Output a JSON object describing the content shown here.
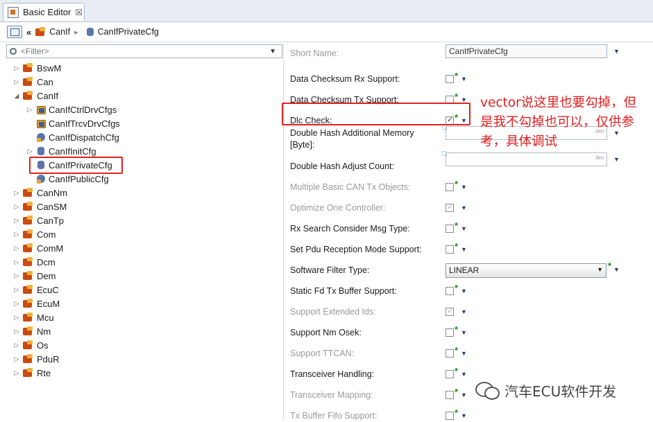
{
  "tab": {
    "title": "Basic Editor",
    "close": "☒"
  },
  "breadcrumb": {
    "back": "«",
    "items": [
      "CanIf",
      "CanIfPrivateCfg"
    ],
    "sep": "▸"
  },
  "filter": {
    "placeholder": "<Filter>",
    "dropdown": "▼"
  },
  "tree": [
    {
      "label": "BswM",
      "arrow": "▷",
      "icon": "package-icon"
    },
    {
      "label": "Can",
      "arrow": "▷",
      "icon": "package-icon"
    },
    {
      "label": "CanIf",
      "arrow": "◢",
      "icon": "package-icon"
    },
    {
      "label": "CanIfCtrlDrvCfgs",
      "arrow": "▷",
      "icon": "container-set-icon"
    },
    {
      "label": "CanIfTrcvDrvCfgs",
      "arrow": "",
      "icon": "container-set-icon"
    },
    {
      "label": "CanIfDispatchCfg",
      "arrow": "",
      "icon": "linked-container-icon"
    },
    {
      "label": "CanIfInitCfg",
      "arrow": "▷",
      "icon": "container-icon"
    },
    {
      "label": "CanIfPrivateCfg",
      "arrow": "",
      "icon": "container-icon"
    },
    {
      "label": "CanIfPublicCfg",
      "arrow": "",
      "icon": "linked-container-icon"
    },
    {
      "label": "CanNm",
      "arrow": "▷",
      "icon": "package-icon"
    },
    {
      "label": "CanSM",
      "arrow": "▷",
      "icon": "package-icon"
    },
    {
      "label": "CanTp",
      "arrow": "▷",
      "icon": "package-icon"
    },
    {
      "label": "Com",
      "arrow": "▷",
      "icon": "package-icon"
    },
    {
      "label": "ComM",
      "arrow": "▷",
      "icon": "package-icon"
    },
    {
      "label": "Dcm",
      "arrow": "▷",
      "icon": "package-icon"
    },
    {
      "label": "Dem",
      "arrow": "▷",
      "icon": "package-icon"
    },
    {
      "label": "EcuC",
      "arrow": "▷",
      "icon": "package-icon"
    },
    {
      "label": "EcuM",
      "arrow": "▷",
      "icon": "package-icon"
    },
    {
      "label": "Mcu",
      "arrow": "▷",
      "icon": "package-icon"
    },
    {
      "label": "Nm",
      "arrow": "▷",
      "icon": "package-icon"
    },
    {
      "label": "Os",
      "arrow": "▷",
      "icon": "package-icon"
    },
    {
      "label": "PduR",
      "arrow": "▷",
      "icon": "package-icon"
    },
    {
      "label": "Rte",
      "arrow": "▷",
      "icon": "package-icon"
    }
  ],
  "properties": {
    "short_name": {
      "label": "Short Name:",
      "value": "CanIfPrivateCfg"
    },
    "rows": [
      {
        "label": "Data Checksum Rx Support:",
        "kind": "checkbox",
        "checked": false,
        "disabled": false
      },
      {
        "label": "Data Checksum Tx Support:",
        "kind": "checkbox",
        "checked": false,
        "disabled": false
      },
      {
        "label": "Dlc Check:",
        "kind": "checkbox",
        "checked": true,
        "disabled": false
      },
      {
        "label": "Double Hash Additional Memory\n[Byte]:",
        "kind": "number",
        "unit": "dec",
        "disabled": false
      },
      {
        "label": "Double Hash Adjust Count:",
        "kind": "number",
        "unit": "dec",
        "disabled": false
      },
      {
        "label": "Multiple Basic CAN Tx Objects:",
        "kind": "checkbox",
        "checked": false,
        "disabled": true
      },
      {
        "label": "Optimize One Controller:",
        "kind": "checkbox",
        "checked": true,
        "disabled": true
      },
      {
        "label": "Rx Search Consider Msg Type:",
        "kind": "checkbox",
        "checked": false,
        "disabled": false
      },
      {
        "label": "Set Pdu Reception Mode Support:",
        "kind": "checkbox",
        "checked": false,
        "disabled": false
      },
      {
        "label": "Software Filter Type:",
        "kind": "select",
        "value": "LINEAR",
        "disabled": false
      },
      {
        "label": "Static Fd Tx Buffer Support:",
        "kind": "checkbox",
        "checked": false,
        "disabled": false
      },
      {
        "label": "Support Extended Ids:",
        "kind": "checkbox",
        "checked": true,
        "disabled": true
      },
      {
        "label": "Support Nm Osek:",
        "kind": "checkbox",
        "checked": false,
        "disabled": false
      },
      {
        "label": "Support TTCAN:",
        "kind": "checkbox",
        "checked": false,
        "disabled": true
      },
      {
        "label": "Transceiver Handling:",
        "kind": "checkbox",
        "checked": false,
        "disabled": false
      },
      {
        "label": "Transceiver Mapping:",
        "kind": "checkbox",
        "checked": false,
        "disabled": true
      },
      {
        "label": "Tx Buffer Fifo Support:",
        "kind": "checkbox",
        "checked": false,
        "disabled": true
      }
    ]
  },
  "annotation": "vector说这里也要勾掉，但是我不勾掉也可以，仅供参考，具体调试",
  "watermark": "汽车ECU软件开发",
  "colors": {
    "highlight": "#e0201e",
    "star": "#1a8a1a"
  }
}
